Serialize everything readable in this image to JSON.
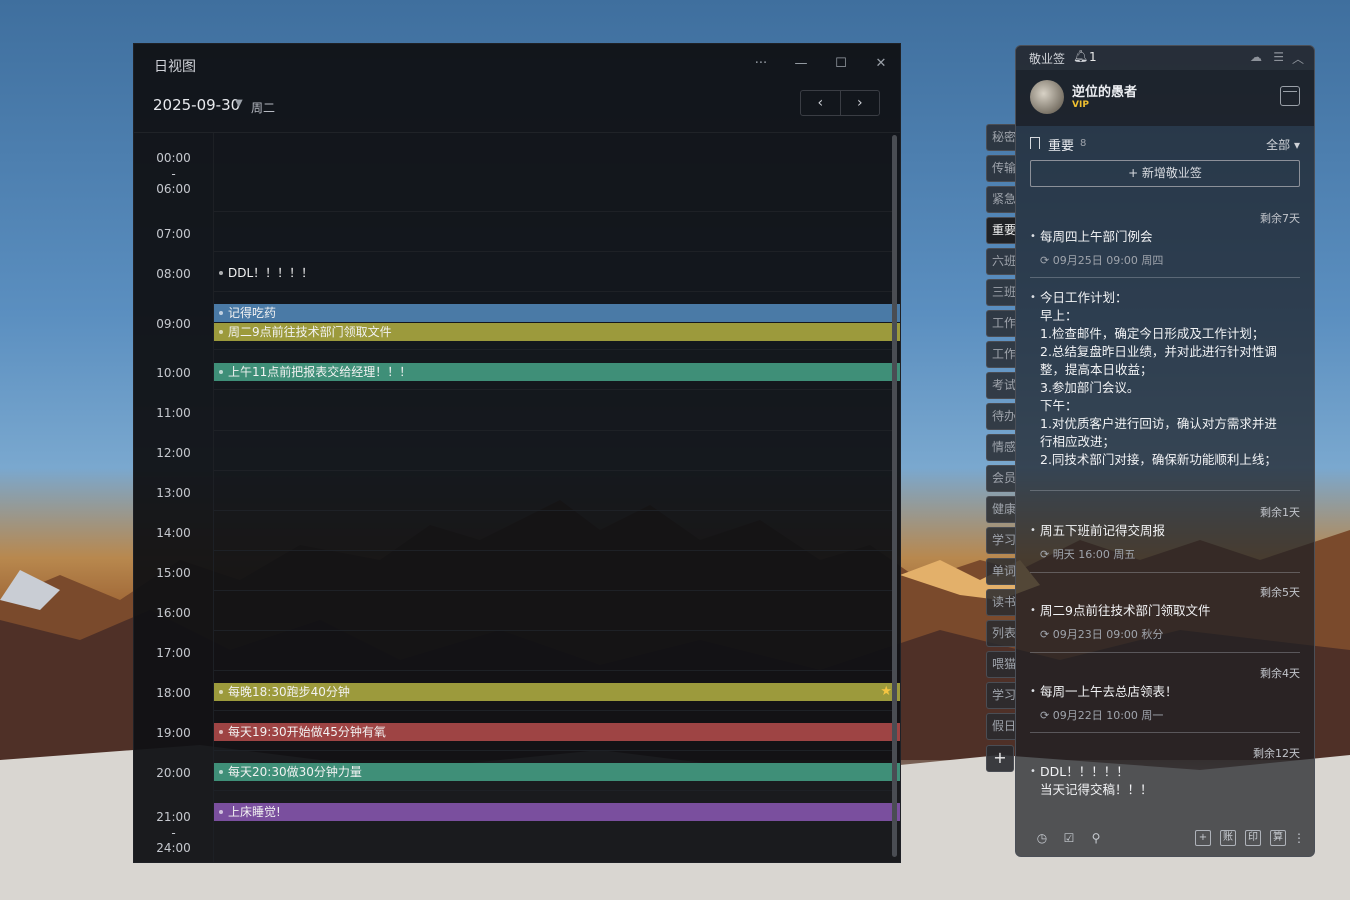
{
  "dayview": {
    "title": "日视图",
    "more": "···",
    "minimize": "—",
    "maximize": "☐",
    "close": "✕",
    "date": "2025-09-30",
    "weekday": "周二",
    "prev": "‹",
    "next": "›",
    "time_labels": [
      "00:00",
      "-",
      "06:00",
      "07:00",
      "08:00",
      "09:00",
      "10:00",
      "11:00",
      "12:00",
      "13:00",
      "14:00",
      "15:00",
      "16:00",
      "17:00",
      "18:00",
      "19:00",
      "20:00",
      "21:00",
      "-",
      "24:00"
    ],
    "events": [
      {
        "label": "DDL！！！！！",
        "color": "plain"
      },
      {
        "label": "记得吃药",
        "color": "blue"
      },
      {
        "label": "周二9点前往技术部门领取文件",
        "color": "olive"
      },
      {
        "label": "上午11点前把报表交给经理！！！",
        "color": "teal"
      },
      {
        "label": "每晚18:30跑步40分钟",
        "color": "olive"
      },
      {
        "label": "每天19:30开始做45分钟有氧",
        "color": "red"
      },
      {
        "label": "每天20:30做30分钟力量",
        "color": "teal"
      },
      {
        "label": "上床睡觉!",
        "color": "purple"
      }
    ],
    "star_icon": "★"
  },
  "tabs": [
    "秘密",
    "传输",
    "紧急",
    "重要",
    "六班",
    "三班",
    "工作",
    "工作",
    "考试",
    "待办",
    "情感",
    "会员",
    "健康",
    "学习",
    "单词",
    "读书",
    "列表",
    "喂猫",
    "学习",
    "假日"
  ],
  "tab_add": "+",
  "panel": {
    "title": "敬业签",
    "bell_count": "1",
    "user": {
      "name": "逆位的愚者",
      "vip": "VIP"
    },
    "section": {
      "label": "重要",
      "count": "8",
      "filter": "全部 ▾"
    },
    "new_button": "+ 新增敬业签",
    "notes": [
      {
        "remain": "剩余7天",
        "lines": [
          "每周四上午部门例会"
        ],
        "meta": "09月25日 09:00 周四"
      },
      {
        "remain": "",
        "lines": [
          "今日工作计划：",
          "早上：",
          "1.检查邮件，确定今日形成及工作计划；",
          "2.总结复盘昨日业绩，并对此进行针对性调",
          "整，提高本日收益；",
          "3.参加部门会议。",
          "下午：",
          "1.对优质客户进行回访，确认对方需求并进",
          "行相应改进；",
          "2.同技术部门对接，确保新功能顺利上线；"
        ],
        "meta": ""
      },
      {
        "remain": "剩余1天",
        "lines": [
          "周五下班前记得交周报"
        ],
        "meta": "明天 16:00 周五"
      },
      {
        "remain": "剩余5天",
        "lines": [
          "周二9点前往技术部门领取文件"
        ],
        "meta": "09月23日 09:00 秋分"
      },
      {
        "remain": "剩余4天",
        "lines": [
          "每周一上午去总店领表！"
        ],
        "meta": "09月22日 10:00 周一"
      },
      {
        "remain": "剩余12天",
        "lines": [
          "DDL！！！！！",
          "当天记得交稿！！！"
        ],
        "meta": ""
      }
    ],
    "footer_right": [
      "+",
      "账",
      "印",
      "算"
    ]
  }
}
